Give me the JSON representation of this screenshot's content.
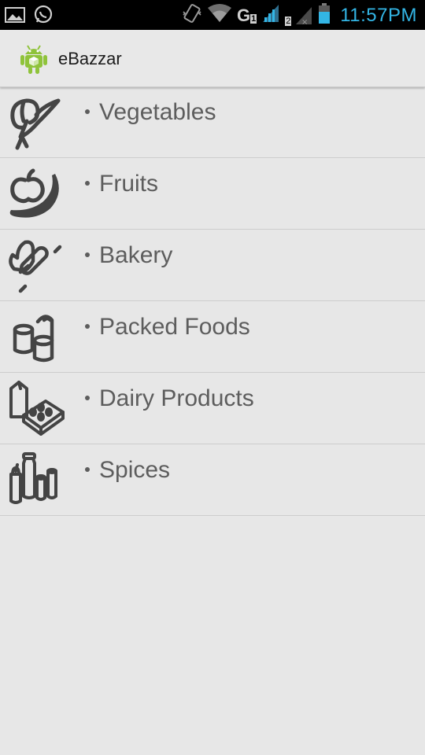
{
  "status_bar": {
    "time": "11:57PM",
    "network": "G",
    "sim1": "1",
    "sim2": "2",
    "icons": [
      "image-icon",
      "whatsapp-icon",
      "vibrate-icon",
      "wifi-icon",
      "signal-icon",
      "battery-icon"
    ],
    "accent_color": "#33b5e5"
  },
  "action_bar": {
    "title": "eBazzar",
    "icon": "android-app-icon"
  },
  "categories": [
    {
      "label": "Vegetables",
      "icon": "vegetables-icon"
    },
    {
      "label": "Fruits",
      "icon": "fruits-icon"
    },
    {
      "label": "Bakery",
      "icon": "bakery-icon"
    },
    {
      "label": "Packed Foods",
      "icon": "packed-foods-icon"
    },
    {
      "label": "Dairy Products",
      "icon": "dairy-products-icon"
    },
    {
      "label": "Spices",
      "icon": "spices-icon"
    }
  ]
}
